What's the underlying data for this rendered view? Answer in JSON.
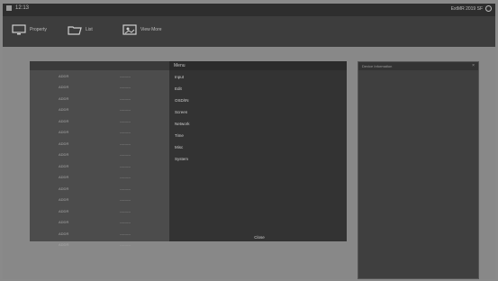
{
  "statusbar": {
    "clock": "12:13",
    "right_text": "ExtMR 2019 SF"
  },
  "toolbar": {
    "items": [
      {
        "label": "Property",
        "icon": "monitor-icon"
      },
      {
        "label": "List",
        "icon": "folder-icon"
      },
      {
        "label": "View More",
        "icon": "image-icon"
      }
    ]
  },
  "table": {
    "rows": [
      {
        "c1": "ADDR",
        "c2": "---------"
      },
      {
        "c1": "ADDR",
        "c2": "---------"
      },
      {
        "c1": "ADDR",
        "c2": "---------"
      },
      {
        "c1": "ADDR",
        "c2": "---------"
      },
      {
        "c1": "ADDR",
        "c2": "---------"
      },
      {
        "c1": "ADDR",
        "c2": "---------"
      },
      {
        "c1": "ADDR",
        "c2": "---------"
      },
      {
        "c1": "ADDR",
        "c2": "---------"
      },
      {
        "c1": "ADDR",
        "c2": "---------"
      },
      {
        "c1": "ADDR",
        "c2": "---------"
      },
      {
        "c1": "ADDR",
        "c2": "---------"
      },
      {
        "c1": "ADDR",
        "c2": "---------"
      },
      {
        "c1": "ADDR",
        "c2": "---------"
      },
      {
        "c1": "ADDR",
        "c2": "---------"
      },
      {
        "c1": "ADDR",
        "c2": "---------"
      },
      {
        "c1": "ADDR",
        "c2": "---------"
      }
    ]
  },
  "menu": {
    "title": "Menu",
    "items": [
      "Input",
      "Edit",
      "OSD/IN",
      "Screen",
      "Network",
      "Time",
      "Misc",
      "System"
    ],
    "close_label": "Close"
  },
  "side_panel": {
    "title": "Device Information",
    "close": "×"
  }
}
